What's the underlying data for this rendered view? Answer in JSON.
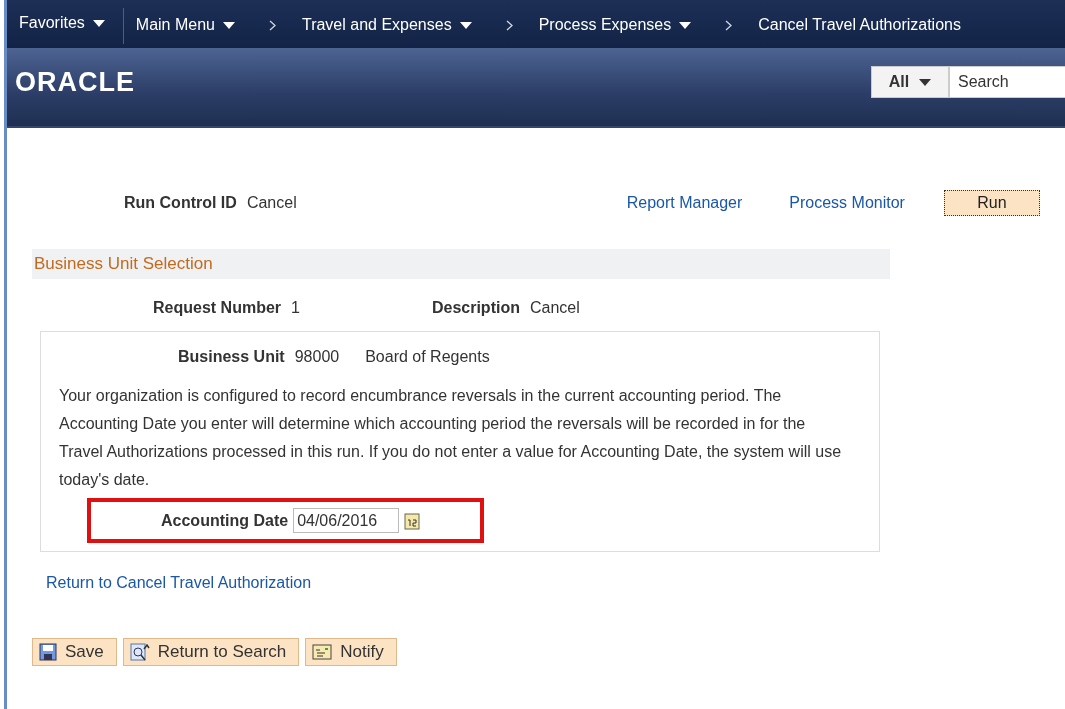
{
  "breadcrumbs": [
    {
      "label": "Favorites",
      "menu": true,
      "separator": false
    },
    {
      "label": "Main Menu",
      "menu": true,
      "separator": false
    },
    {
      "label": "Travel and Expenses",
      "menu": true,
      "separator": true
    },
    {
      "label": "Process Expenses",
      "menu": true,
      "separator": true
    },
    {
      "label": "Cancel Travel Authorizations",
      "menu": false,
      "separator": true
    }
  ],
  "header": {
    "logo": "ORACLE",
    "search_scope": "All",
    "search": {
      "placeholder": "Search"
    }
  },
  "run_control": {
    "label": "Run Control ID",
    "value": "Cancel",
    "links": [
      "Report Manager",
      "Process Monitor"
    ],
    "run_button": "Run"
  },
  "section_title": "Business Unit Selection",
  "request": {
    "number_label": "Request Number",
    "number": "1",
    "description_label": "Description",
    "description": "Cancel"
  },
  "business_unit": {
    "label": "Business Unit",
    "code": "98000",
    "name": "Board of Regents"
  },
  "note": "Your organization is configured to record encumbrance reversals in the current accounting period. The Accounting Date you enter will determine which accounting period the reversals will be recorded in for the Travel Authorizations processed in this run. If you do not enter a value for Accounting Date, the system will use today's date.",
  "accounting_date": {
    "label": "Accounting Date",
    "value": "04/06/2016",
    "highlighted": true
  },
  "return_link": "Return to Cancel Travel Authorization",
  "buttons": [
    {
      "kind": "save",
      "label": "Save"
    },
    {
      "kind": "search",
      "label": "Return to Search"
    },
    {
      "kind": "notify",
      "label": "Notify"
    }
  ]
}
